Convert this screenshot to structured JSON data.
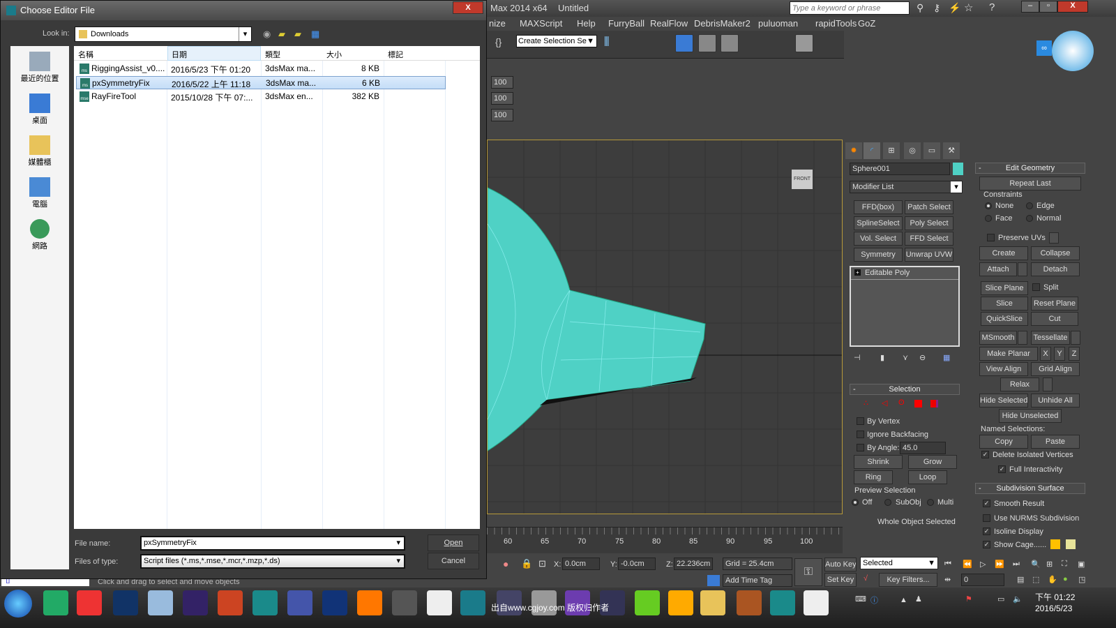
{
  "max_window": {
    "title": "Max  2014 x64",
    "document": "Untitled",
    "search_placeholder": "Type a keyword or phrase",
    "menu": [
      "nize",
      "MAXScript",
      "Help",
      "FurryBall",
      "RealFlow",
      "DebrisMaker2",
      "puluoman",
      "rapidTools",
      "GoZ"
    ],
    "selection_set": "Create Selection Se",
    "spinners": [
      "100",
      "100",
      "100"
    ],
    "viewcube_label": "FRONT"
  },
  "command_panel": {
    "object_name": "Sphere001",
    "object_color": "#4fd1c5",
    "modifier_list": "Modifier List",
    "modifier_buttons": [
      "FFD(box)",
      "Patch Select",
      "SplineSelect",
      "Poly Select",
      "Vol. Select",
      "FFD Select",
      "Symmetry",
      "Unwrap UVW"
    ],
    "stack_item": "Editable Poly",
    "selection": {
      "title": "Selection",
      "by_vertex": "By Vertex",
      "ignore_backfacing": "Ignore Backfacing",
      "by_angle": "By Angle:",
      "angle_value": "45.0",
      "shrink": "Shrink",
      "grow": "Grow",
      "ring": "Ring",
      "loop": "Loop",
      "preview_title": "Preview Selection",
      "preview_off": "Off",
      "preview_subobj": "SubObj",
      "preview_multi": "Multi",
      "status": "Whole Object Selected"
    },
    "edit_geometry": {
      "title": "Edit Geometry",
      "repeat_last": "Repeat Last",
      "constraints": "Constraints",
      "none": "None",
      "edge": "Edge",
      "face": "Face",
      "normal": "Normal",
      "preserve_uvs": "Preserve UVs",
      "create": "Create",
      "collapse": "Collapse",
      "attach": "Attach",
      "detach": "Detach",
      "slice_plane": "Slice Plane",
      "split": "Split",
      "slice": "Slice",
      "reset_plane": "Reset Plane",
      "quickslice": "QuickSlice",
      "cut": "Cut",
      "msmooth": "MSmooth",
      "tessellate": "Tessellate",
      "make_planar": "Make Planar",
      "x": "X",
      "y": "Y",
      "z": "Z",
      "view_align": "View Align",
      "grid_align": "Grid Align",
      "relax": "Relax",
      "hide_selected": "Hide Selected",
      "unhide_all": "Unhide All",
      "hide_unselected": "Hide Unselected",
      "named_selections": "Named Selections:",
      "copy": "Copy",
      "paste": "Paste",
      "delete_isolated": "Delete Isolated Vertices",
      "full_interactivity": "Full Interactivity"
    },
    "subdivision": {
      "title": "Subdivision Surface",
      "smooth_result": "Smooth Result",
      "use_nurms": "Use NURMS Subdivision",
      "isoline": "Isoline Display",
      "show_cage": "Show Cage......",
      "cage_colors": [
        "#ffc000",
        "#e8e49a"
      ]
    }
  },
  "timeline": {
    "ticks": [
      "60",
      "65",
      "70",
      "75",
      "80",
      "85",
      "90",
      "95",
      "100"
    ]
  },
  "status_bar": {
    "x_label": "X:",
    "x": "0.0cm",
    "y_label": "Y:",
    "y": "-0.0cm",
    "z_label": "Z:",
    "z": "22.236cm",
    "grid": "Grid = 25.4cm",
    "add_time_tag": "Add Time Tag",
    "auto_key": "Auto Key",
    "set_key": "Set Key",
    "key_mode": "Selected",
    "key_filters": "Key Filters...",
    "frame": "0",
    "prompt": "Click and drag to select and move objects",
    "script_listener": "\"[]"
  },
  "dialog": {
    "title": "Choose Editor File",
    "look_in_label": "Look in:",
    "look_in": "Downloads",
    "places": [
      "最近的位置",
      "桌面",
      "媒體櫃",
      "電腦",
      "網路"
    ],
    "columns": [
      "名稱",
      "日期",
      "類型",
      "大小",
      "標記"
    ],
    "files": [
      {
        "name": "RiggingAssist_v0....",
        "date": "2016/5/23 下午 01:20",
        "type": "3dsMax ma...",
        "size": "8 KB",
        "icon": "ms",
        "selected": false
      },
      {
        "name": "pxSymmetryFix",
        "date": "2016/5/22 上午 11:18",
        "type": "3dsMax ma...",
        "size": "6 KB",
        "icon": "ms",
        "selected": true
      },
      {
        "name": "RayFireTool",
        "date": "2015/10/28 下午 07:...",
        "type": "3dsMax en...",
        "size": "382 KB",
        "icon": "mse",
        "selected": false
      }
    ],
    "file_name_label": "File name:",
    "file_name": "pxSymmetryFix",
    "file_type_label": "Files of type:",
    "file_type": "Script files (*.ms,*.mse,*.mcr,*.mzp,*.ds)",
    "open": "Open",
    "cancel": "Cancel"
  },
  "taskbar": {
    "time": "下午 01:22",
    "date": "2016/5/23",
    "watermark": "出自www.cgjoy.com 版权归作者",
    "apps": [
      "Task Manager",
      "Chrome",
      "Photoshop",
      "Notepad",
      "After Effects",
      "Mudbox",
      "Maya",
      "Cinema 4D",
      "Premiere",
      "Blender",
      "Tablet",
      "ZBrush",
      "3ds Max",
      "Cinema 4D",
      "Ornatrix",
      "Visual Studio",
      "Brush",
      "Green",
      "Marvelous",
      "Explorer",
      "Painter",
      "MotionBuilder",
      "ZBrush"
    ]
  }
}
